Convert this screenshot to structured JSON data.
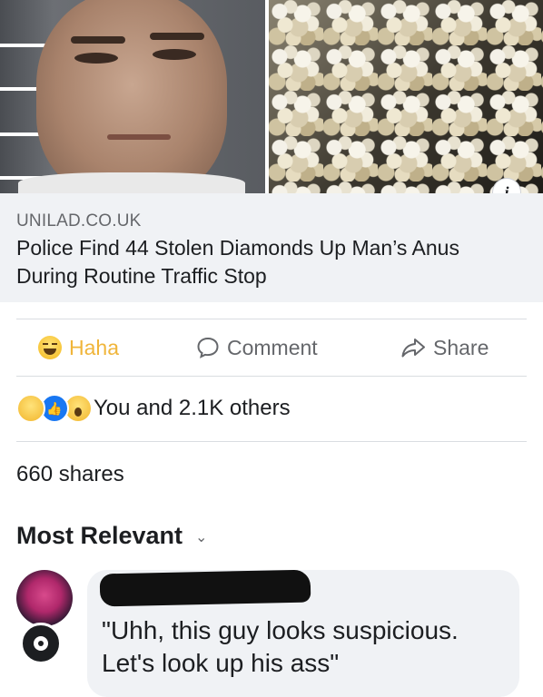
{
  "preview": {
    "source": "UNILAD.CO.UK",
    "headline": "Police Find 44 Stolen Diamonds Up Man’s Anus During Routine Traffic Stop",
    "info_icon": "info-icon",
    "info_glyph": "i"
  },
  "actions": {
    "haha_label": "Haha",
    "comment_label": "Comment",
    "share_label": "Share",
    "haha_color": "#f0b53a",
    "icons": [
      "haha-emoji-icon",
      "comment-icon",
      "share-icon"
    ]
  },
  "reactions": {
    "icons": [
      "haha-reaction-icon",
      "like-reaction-icon",
      "wow-reaction-icon"
    ],
    "summary": "You and 2.1K others"
  },
  "shares": {
    "text": "660 shares"
  },
  "comments": {
    "sort_label": "Most Relevant",
    "sort_icon": "chevron-down-icon",
    "first": {
      "text": "\"Uhh, this guy looks suspicious. Let's look up his ass\""
    }
  },
  "colors": {
    "link_blue": "#1877f2",
    "secondary_text": "#65676b",
    "bubble_bg": "#f0f2f5"
  }
}
